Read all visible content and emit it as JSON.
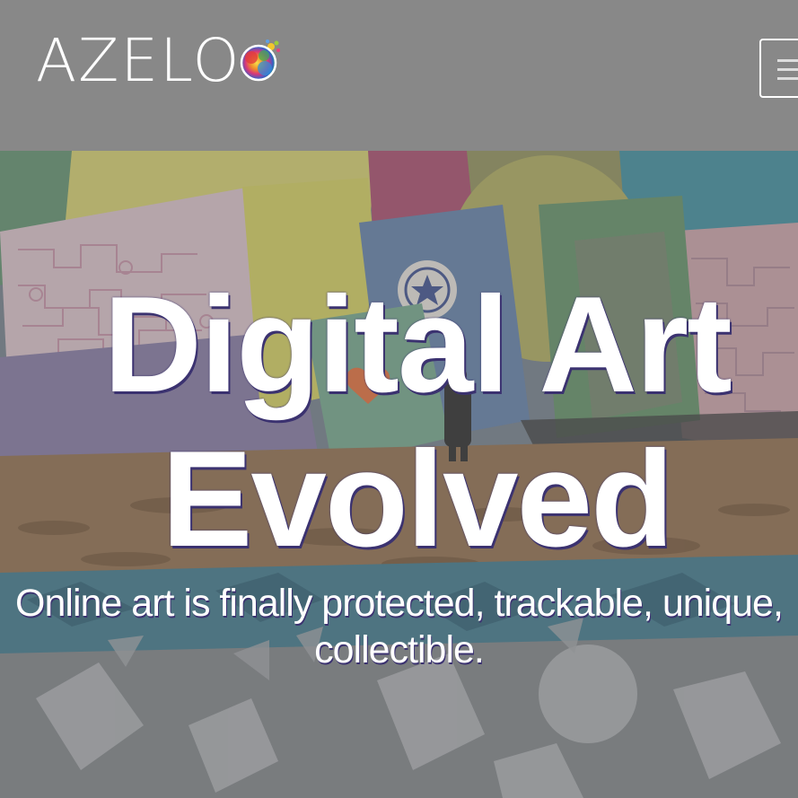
{
  "header": {
    "logo_text": "AZELO",
    "menu_icon": "hamburger-menu-icon"
  },
  "hero": {
    "title_line1": "Digital Art",
    "title_line2": "Evolved",
    "subtitle": "Online art is finally protected, trackable, unique, collectible."
  },
  "colors": {
    "header_bg": "#888888",
    "text": "#ffffff",
    "title_shadow": "#3b3270"
  }
}
